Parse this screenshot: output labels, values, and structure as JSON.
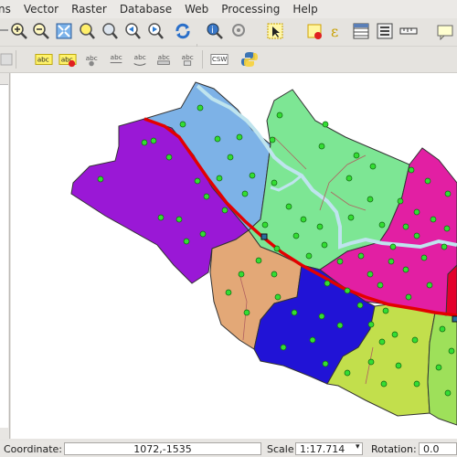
{
  "menubar": {
    "items": [
      "ns",
      "Vector",
      "Raster",
      "Database",
      "Web",
      "Processing",
      "Help"
    ]
  },
  "toolbar1": {
    "icons": [
      "pan-hand-icon",
      "zoom-in-icon",
      "zoom-out-icon",
      "zoom-full-icon",
      "zoom-selection-icon",
      "zoom-layer-icon",
      "zoom-last-icon",
      "zoom-next-icon",
      "refresh-icon",
      "identify-icon",
      "action-icon",
      "select-features-icon",
      "deselect-icon",
      "expression-select-icon",
      "attribute-table-icon",
      "field-calculator-icon",
      "measure-icon",
      "map-tips-icon"
    ]
  },
  "toolbar2": {
    "icons": [
      "edit-icon",
      "label-abc-icon",
      "label-highlight-icon",
      "label-pin-icon",
      "label-move-icon",
      "label-rotate-icon",
      "label-change-icon",
      "label-show-icon",
      "csw-icon",
      "python-icon"
    ],
    "csw_text": "CSW",
    "abc_text": "abc"
  },
  "statusbar": {
    "coordinate_label": "Coordinate:",
    "coordinate_value": "1072,-1535",
    "scale_label": "Scale",
    "scale_value": "1:17.714",
    "rotation_label": "Rotation:",
    "rotation_value": "0.0"
  },
  "map": {
    "colors": {
      "purple": "#9a18d6",
      "blue": "#7db2e7",
      "green": "#7de694",
      "magenta": "#e21fa3",
      "orange": "#e3a877",
      "navy": "#2113d6",
      "lime": "#c2df4c",
      "lightgreen": "#9ee05a",
      "red": "#e30000",
      "river": "#bfe4ee",
      "point": "#33dd33"
    }
  }
}
